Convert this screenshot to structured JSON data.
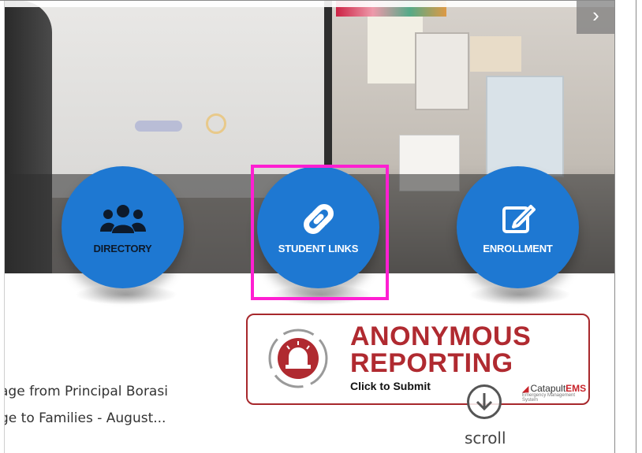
{
  "hero": {
    "next_arrow": "›"
  },
  "quick_links": [
    {
      "label": "DIRECTORY",
      "icon": "users-icon"
    },
    {
      "label": "STUDENT LINKS",
      "icon": "link-icon"
    },
    {
      "label": "ENROLLMENT",
      "icon": "edit-icon"
    }
  ],
  "report": {
    "line1": "ANONYMOUS",
    "line2": "REPORTING",
    "cta": "Click to Submit",
    "brand_prefix": "Catapult",
    "brand_suffix": "EMS",
    "brand_tagline": "Emergency Management System"
  },
  "news": [
    {
      "text": "age from Principal Borasi"
    },
    {
      "text": "ge to Families - August..."
    }
  ],
  "scroll": {
    "label": "scroll"
  },
  "colors": {
    "accent_blue": "#1e78d2",
    "report_red": "#b02a30",
    "highlight": "#ff1fd2"
  }
}
